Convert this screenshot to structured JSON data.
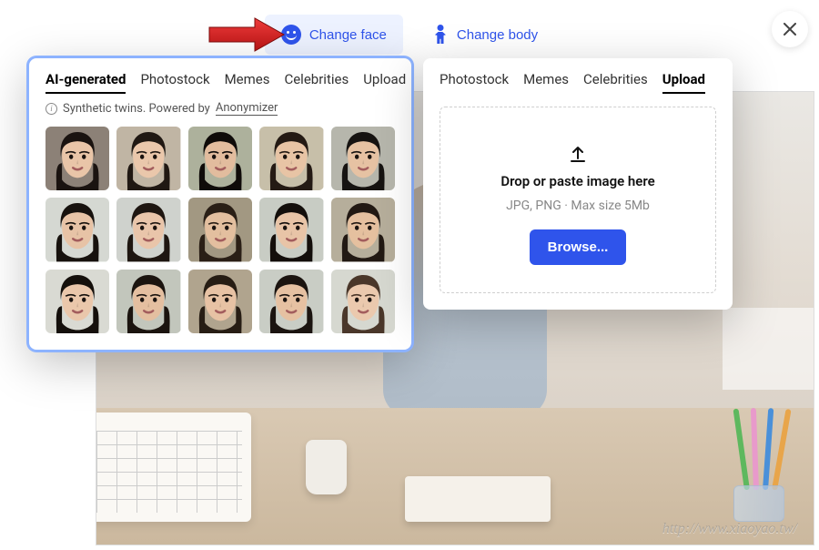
{
  "toggle": {
    "face_label": "Change face",
    "body_label": "Change body"
  },
  "face_panel": {
    "tabs": [
      "AI-generated",
      "Photostock",
      "Memes",
      "Celebrities",
      "Upload"
    ],
    "active_tab": 0,
    "note_prefix": "Synthetic twins. Powered by ",
    "note_link": "Anonymizer",
    "grid_count": 15
  },
  "body_panel": {
    "tabs": [
      "Photostock",
      "Memes",
      "Celebrities",
      "Upload"
    ],
    "active_tab": 3,
    "drop_message": "Drop or paste image here",
    "drop_hint": "JPG, PNG · Max size 5Mb",
    "browse_label": "Browse..."
  },
  "watermark": "http://www.xiaoyao.tw/",
  "colors": {
    "primary": "#2f54eb",
    "primary_bg": "#edf2ff"
  },
  "face_variants": [
    {
      "skin": "#e9c5a8",
      "hair": "#1a1310",
      "bg": "#8c8177"
    },
    {
      "skin": "#eac7ab",
      "hair": "#201813",
      "bg": "#c0b5a4"
    },
    {
      "skin": "#e2bc9e",
      "hair": "#0f0b09",
      "bg": "#adb19c"
    },
    {
      "skin": "#e8c4a5",
      "hair": "#241a14",
      "bg": "#c7bfa9"
    },
    {
      "skin": "#e6c2a3",
      "hair": "#161311",
      "bg": "#b6b6ac"
    },
    {
      "skin": "#e7c3a6",
      "hair": "#17120e",
      "bg": "#d5d8d2"
    },
    {
      "skin": "#e9c5aa",
      "hair": "#1e1611",
      "bg": "#cfd2cd"
    },
    {
      "skin": "#e3bf9f",
      "hair": "#2a1f16",
      "bg": "#a29882"
    },
    {
      "skin": "#e8c4a7",
      "hair": "#130e0b",
      "bg": "#c8ccc4"
    },
    {
      "skin": "#e5c09f",
      "hair": "#221913",
      "bg": "#b6ae9b"
    },
    {
      "skin": "#eac7ab",
      "hair": "#15100c",
      "bg": "#d9dad3"
    },
    {
      "skin": "#e4bfa0",
      "hair": "#1b140f",
      "bg": "#c2c6bc"
    },
    {
      "skin": "#e7c2a4",
      "hair": "#271d14",
      "bg": "#b0a48e"
    },
    {
      "skin": "#e6c1a2",
      "hair": "#1b1410",
      "bg": "#c9cdc5"
    },
    {
      "skin": "#ebc9ae",
      "hair": "#4a372a",
      "bg": "#d6d8d0"
    }
  ]
}
